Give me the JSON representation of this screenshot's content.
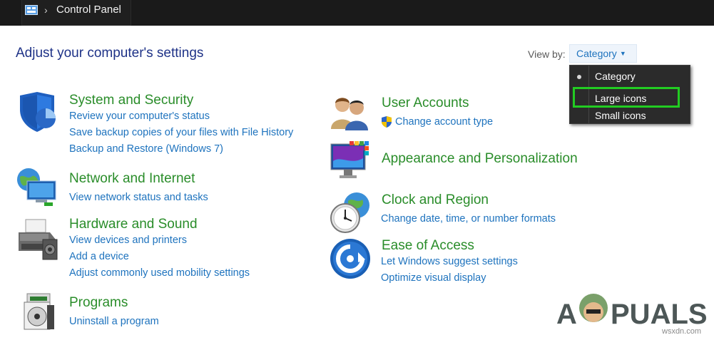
{
  "titlebar": {
    "breadcrumb": "Control Panel"
  },
  "header": {
    "title": "Adjust your computer's settings"
  },
  "view_by": {
    "label": "View by:",
    "selected": "Category",
    "options": [
      "Category",
      "Large icons",
      "Small icons"
    ]
  },
  "left_categories": [
    {
      "title": "System and Security",
      "links": [
        "Review your computer's status",
        "Save backup copies of your files with File History",
        "Backup and Restore (Windows 7)"
      ]
    },
    {
      "title": "Network and Internet",
      "links": [
        "View network status and tasks"
      ]
    },
    {
      "title": "Hardware and Sound",
      "links": [
        "View devices and printers",
        "Add a device",
        "Adjust commonly used mobility settings"
      ]
    },
    {
      "title": "Programs",
      "links": [
        "Uninstall a program"
      ]
    }
  ],
  "right_categories": [
    {
      "title": "User Accounts",
      "links": [
        "Change account type"
      ]
    },
    {
      "title": "Appearance and Personalization",
      "links": []
    },
    {
      "title": "Clock and Region",
      "links": [
        "Change date, time, or number formats"
      ]
    },
    {
      "title": "Ease of Access",
      "links": [
        "Let Windows suggest settings",
        "Optimize visual display"
      ]
    }
  ],
  "watermark": {
    "brand": "A PUALS",
    "site": "wsxdn.com"
  },
  "colors": {
    "title_blue": "#1e3287",
    "category_green": "#2a8d2a",
    "link_blue": "#1e73be",
    "highlight_green": "#22cc22"
  }
}
